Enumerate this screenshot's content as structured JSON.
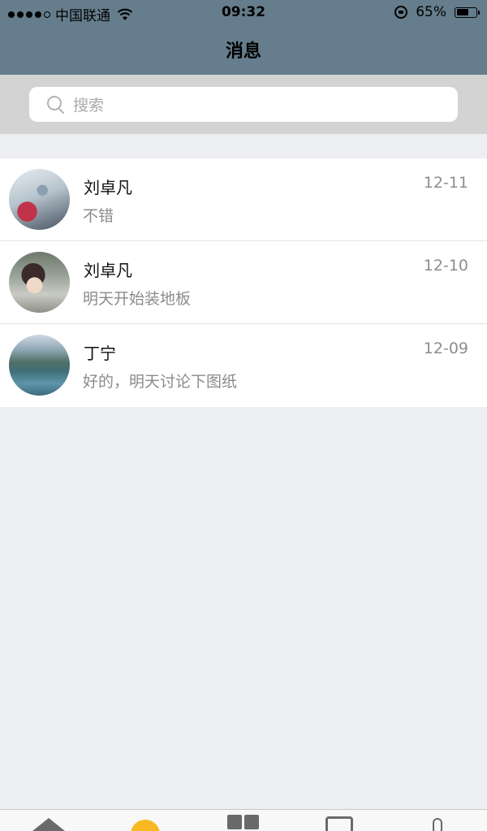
{
  "status_bar": {
    "carrier": "中国联通",
    "time": "09:32",
    "battery": "65%",
    "battery_level": 0.65
  },
  "nav": {
    "title": "消息"
  },
  "search": {
    "placeholder": "搜索"
  },
  "messages": [
    {
      "name": "刘卓凡",
      "preview": "不错",
      "time": "12-11"
    },
    {
      "name": "刘卓凡",
      "preview": "明天开始装地板",
      "time": "12-10"
    },
    {
      "name": "丁宁",
      "preview": "好的，明天讨论下图纸",
      "time": "12-09"
    }
  ],
  "colors": {
    "header_bg": "#657d8c",
    "background": "#edeef2",
    "accent": "#f8b822"
  },
  "icons": {
    "signal": "signal-dots-icon",
    "wifi": "wifi-icon",
    "rotation_lock": "rotation-lock-icon",
    "battery": "battery-icon",
    "search": "search-icon",
    "tabs": [
      "home-icon",
      "messages-icon",
      "grid-icon",
      "box-icon",
      "user-icon"
    ]
  }
}
